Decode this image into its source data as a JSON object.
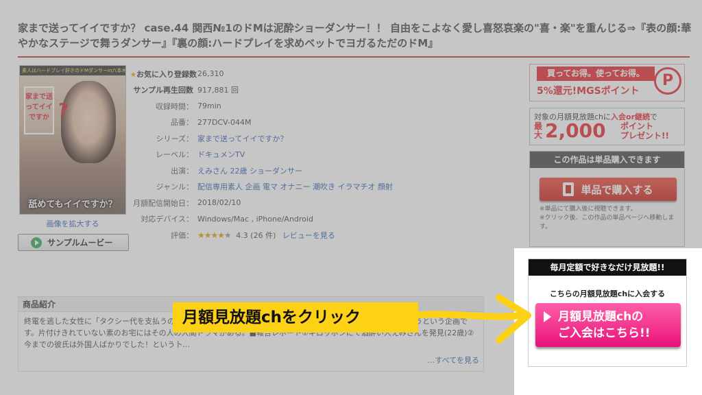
{
  "product": {
    "title": "家まで送ってイイですか？ case.44 関西№1のドMは泥酔ショーダンサー！！ 自由をこよなく愛し喜怒哀楽の\"喜・楽\"を重んじる⇒『表の顔:華やかなステージで舞うダンサー』『裏の顔:ハードプレイを求めベットでヨガるただのドM』",
    "cover": {
      "banner": "素人はハードプレイ好きのドMダンサーin六本木",
      "house_text": "家まで送ってイイですか",
      "question_mark": "?",
      "caption": "舐めてもイイですか？"
    },
    "enlarge_label": "画像を拡大する",
    "sample_movie_label": "サンプルムービー"
  },
  "specs": [
    {
      "label": "お気に入り登録数",
      "value": "26,310",
      "star": "★"
    },
    {
      "label": "サンプル再生回数",
      "value": "917,881 回"
    },
    {
      "label": "収録時間：",
      "value": "79min"
    },
    {
      "label": "品番：",
      "value": "277DCV-044M"
    },
    {
      "label": "シリーズ：",
      "value": "家まで送ってイイですか？"
    },
    {
      "label": "レーベル：",
      "value": "ドキュメンTV"
    },
    {
      "label": "出演：",
      "value": "えみさん 22歳 ショーダンサー"
    },
    {
      "label": "ジャンル：",
      "value": "配信専用素人 企画 電マ オナニー 潮吹き イラマチオ 顔射"
    },
    {
      "label": "月額配信開始日：",
      "value": "2018/02/10"
    },
    {
      "label": "対応デバイス：",
      "value": "Windows/Mac , iPhone/Android"
    },
    {
      "label": "評価：",
      "stars_filled": "★★★★",
      "stars_empty": "★",
      "score": "4.3 (26 件)",
      "review_link": "レビューを見る",
      "rating": 4.3
    }
  ],
  "intro": {
    "heading": "商品紹介",
    "text": "終電を逃した女性に「タクシー代を支払うので家まで行ってもイイですか？」とお願いして家まで行ってやっちゃおうという企画です。片付けきれていない素のお宅にはその人の人間ドラマがある。■報告レポート①ギロッポンにて酒酔い人えみさんを発見(22歳)②今までの彼氏は外国人ばかりでした！という卜…",
    "more_link": "…すべてを見る"
  },
  "sidebar": {
    "ad_points": {
      "line1": "買ってお得。使ってお得。",
      "line2": "5%還元!MGSポイント",
      "badge": "P"
    },
    "ad_present": {
      "line1_a": "対象の月額見放題chに",
      "line1_b": "入会or継続",
      "line1_c": "で",
      "saidai": "最大",
      "amount": "2,000",
      "pt_line1": "ポイント",
      "pt_line2": "プレゼント!!"
    },
    "single_purchase": {
      "heading": "この作品は単品購入できます",
      "button": "単品で購入する",
      "note1": "※単品にて購入後に視聴できます。",
      "note2": "※クリック後、この作品の単品ページへ移動します。"
    },
    "monthly": {
      "heading": "毎月定額で好きなだけ見放題!!",
      "subheading": "こちらの月額見放題chに入会する",
      "button_line1": "月額見放題chの",
      "button_line2": "ご入会はこちら!!"
    }
  },
  "annotation": {
    "callout": "月額見放題chをクリック"
  },
  "colors": {
    "accent_red": "#e8262d",
    "pink_button": "#e8137a",
    "callout_yellow": "#fcd116"
  }
}
